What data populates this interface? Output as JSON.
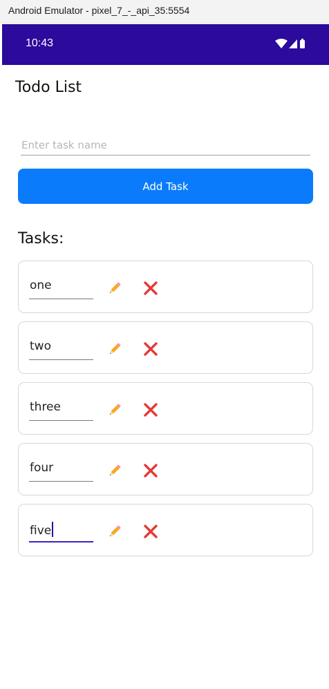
{
  "window": {
    "title": "Android Emulator - pixel_7_-_api_35:5554"
  },
  "statusbar": {
    "time": "10:43",
    "icons": [
      "wifi-icon",
      "signal-icon",
      "battery-icon"
    ],
    "background": "#2b0a9c"
  },
  "app": {
    "title": "Todo List",
    "input_placeholder": "Enter task name",
    "add_button_label": "Add Task",
    "tasks_heading": "Tasks:",
    "accent": "#0a7cfb",
    "tasks": [
      {
        "text": "one",
        "focused": false
      },
      {
        "text": "two",
        "focused": false
      },
      {
        "text": "three",
        "focused": false
      },
      {
        "text": "four",
        "focused": false
      },
      {
        "text": "five",
        "focused": true
      }
    ],
    "task_icons": {
      "edit": "pencil-icon",
      "delete": "close-x-icon"
    },
    "delete_color": "#e53935"
  }
}
